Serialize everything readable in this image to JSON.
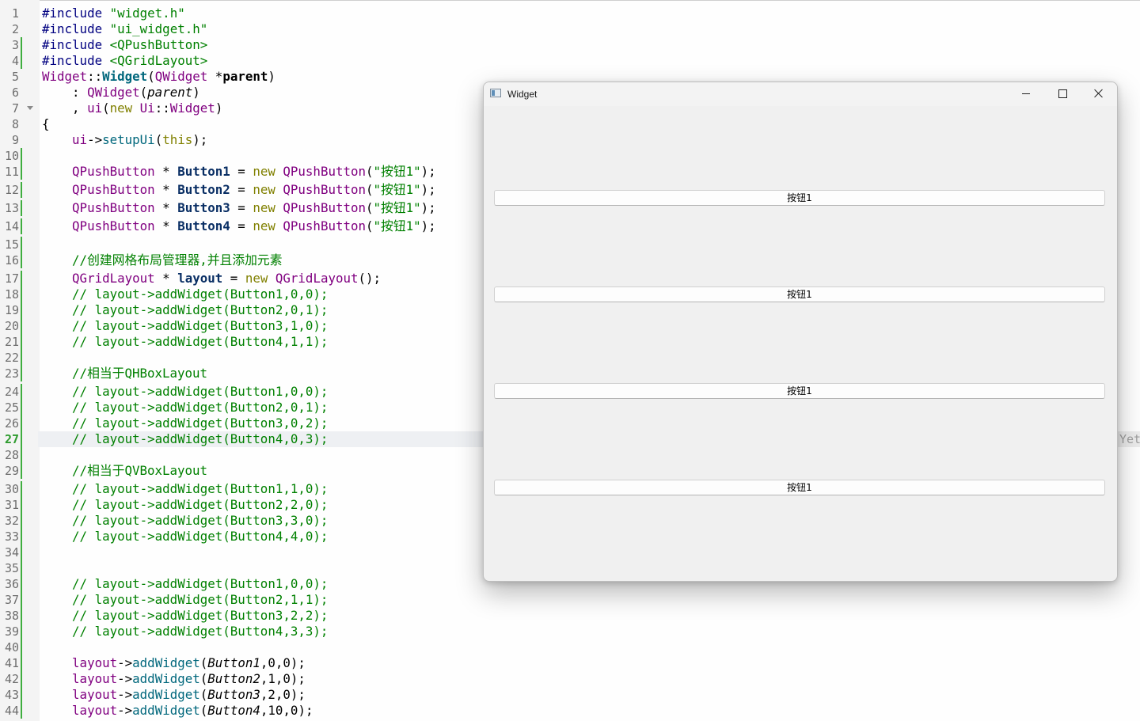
{
  "editor": {
    "current_line": 27,
    "modified_lines": [
      3,
      4,
      10,
      11,
      12,
      13,
      14,
      15,
      16,
      17,
      18,
      19,
      20,
      21,
      22,
      23,
      24,
      25,
      26,
      27,
      28,
      29,
      30,
      31,
      32,
      33,
      34,
      35,
      36,
      37,
      38,
      39,
      40,
      41,
      42,
      43,
      44
    ],
    "fold_markers": [
      7
    ],
    "lines": [
      {
        "n": "1",
        "tokens": [
          [
            "pp",
            "#include "
          ],
          [
            "str",
            "\"widget.h\""
          ]
        ]
      },
      {
        "n": "2",
        "tokens": [
          [
            "pp",
            "#include "
          ],
          [
            "str",
            "\"ui_widget.h\""
          ]
        ]
      },
      {
        "n": "3",
        "tokens": [
          [
            "pp",
            "#include "
          ],
          [
            "ang",
            "<QPushButton>"
          ]
        ]
      },
      {
        "n": "4",
        "tokens": [
          [
            "pp",
            "#include "
          ],
          [
            "ang",
            "<QGridLayout>"
          ]
        ]
      },
      {
        "n": "5",
        "tokens": [
          [
            "cls",
            "Widget"
          ],
          [
            "",
            "::"
          ],
          [
            "fnb",
            "Widget"
          ],
          [
            "",
            "("
          ],
          [
            "cls",
            "QWidget"
          ],
          [
            "",
            " *"
          ],
          [
            "b",
            "parent"
          ],
          [
            "",
            ")"
          ]
        ]
      },
      {
        "n": "6",
        "tokens": [
          [
            "",
            "    : "
          ],
          [
            "cls",
            "QWidget"
          ],
          [
            "",
            "("
          ],
          [
            "par",
            "parent"
          ],
          [
            "",
            ")"
          ]
        ]
      },
      {
        "n": "7",
        "tokens": [
          [
            "",
            "    , "
          ],
          [
            "ns",
            "ui"
          ],
          [
            "",
            "("
          ],
          [
            "kw",
            "new "
          ],
          [
            "cls",
            "Ui"
          ],
          [
            "",
            "::"
          ],
          [
            "cls",
            "Widget"
          ],
          [
            "",
            ")"
          ]
        ]
      },
      {
        "n": "8",
        "tokens": [
          [
            "",
            "{"
          ]
        ]
      },
      {
        "n": "9",
        "tokens": [
          [
            "",
            "    "
          ],
          [
            "ns",
            "ui"
          ],
          [
            "",
            "->"
          ],
          [
            "fn",
            "setupUi"
          ],
          [
            "",
            "("
          ],
          [
            "kw",
            "this"
          ],
          [
            "",
            ");"
          ]
        ]
      },
      {
        "n": "10",
        "tokens": []
      },
      {
        "n": "11",
        "tokens": [
          [
            "",
            "    "
          ],
          [
            "cls",
            "QPushButton"
          ],
          [
            "",
            " * "
          ],
          [
            "field",
            "Button1"
          ],
          [
            "",
            " = "
          ],
          [
            "kw",
            "new "
          ],
          [
            "cls",
            "QPushButton"
          ],
          [
            "",
            "("
          ],
          [
            "str",
            "\"按钮1\""
          ],
          [
            "",
            ");"
          ]
        ]
      },
      {
        "n": "12",
        "tokens": [
          [
            "",
            "    "
          ],
          [
            "cls",
            "QPushButton"
          ],
          [
            "",
            " * "
          ],
          [
            "field",
            "Button2"
          ],
          [
            "",
            " = "
          ],
          [
            "kw",
            "new "
          ],
          [
            "cls",
            "QPushButton"
          ],
          [
            "",
            "("
          ],
          [
            "str",
            "\"按钮1\""
          ],
          [
            "",
            ");"
          ]
        ]
      },
      {
        "n": "13",
        "tokens": [
          [
            "",
            "    "
          ],
          [
            "cls",
            "QPushButton"
          ],
          [
            "",
            " * "
          ],
          [
            "field",
            "Button3"
          ],
          [
            "",
            " = "
          ],
          [
            "kw",
            "new "
          ],
          [
            "cls",
            "QPushButton"
          ],
          [
            "",
            "("
          ],
          [
            "str",
            "\"按钮1\""
          ],
          [
            "",
            ");"
          ]
        ]
      },
      {
        "n": "14",
        "tokens": [
          [
            "",
            "    "
          ],
          [
            "cls",
            "QPushButton"
          ],
          [
            "",
            " * "
          ],
          [
            "field",
            "Button4"
          ],
          [
            "",
            " = "
          ],
          [
            "kw",
            "new "
          ],
          [
            "cls",
            "QPushButton"
          ],
          [
            "",
            "("
          ],
          [
            "str",
            "\"按钮1\""
          ],
          [
            "",
            ");"
          ]
        ]
      },
      {
        "n": "15",
        "tokens": []
      },
      {
        "n": "16",
        "tokens": [
          [
            "com",
            "    //创建网格布局管理器,并且添加元素"
          ]
        ]
      },
      {
        "n": "17",
        "tokens": [
          [
            "",
            "    "
          ],
          [
            "cls",
            "QGridLayout"
          ],
          [
            "",
            " * "
          ],
          [
            "field",
            "layout"
          ],
          [
            "",
            " = "
          ],
          [
            "kw",
            "new "
          ],
          [
            "cls",
            "QGridLayout"
          ],
          [
            "",
            "();"
          ]
        ]
      },
      {
        "n": "18",
        "tokens": [
          [
            "com",
            "    // layout->addWidget(Button1,0,0);"
          ]
        ]
      },
      {
        "n": "19",
        "tokens": [
          [
            "com",
            "    // layout->addWidget(Button2,0,1);"
          ]
        ]
      },
      {
        "n": "20",
        "tokens": [
          [
            "com",
            "    // layout->addWidget(Button3,1,0);"
          ]
        ]
      },
      {
        "n": "21",
        "tokens": [
          [
            "com",
            "    // layout->addWidget(Button4,1,1);"
          ]
        ]
      },
      {
        "n": "22",
        "tokens": []
      },
      {
        "n": "23",
        "tokens": [
          [
            "com",
            "    //相当于QHBoxLayout"
          ]
        ]
      },
      {
        "n": "24",
        "tokens": [
          [
            "com",
            "    // layout->addWidget(Button1,0,0);"
          ]
        ]
      },
      {
        "n": "25",
        "tokens": [
          [
            "com",
            "    // layout->addWidget(Button2,0,1);"
          ]
        ]
      },
      {
        "n": "26",
        "tokens": [
          [
            "com",
            "    // layout->addWidget(Button3,0,2);"
          ]
        ]
      },
      {
        "n": "27",
        "tokens": [
          [
            "com",
            "    // layout->addWidget(Button4,0,3);"
          ]
        ]
      },
      {
        "n": "28",
        "tokens": []
      },
      {
        "n": "29",
        "tokens": [
          [
            "com",
            "    //相当于QVBoxLayout"
          ]
        ]
      },
      {
        "n": "30",
        "tokens": [
          [
            "com",
            "    // layout->addWidget(Button1,1,0);"
          ]
        ]
      },
      {
        "n": "31",
        "tokens": [
          [
            "com",
            "    // layout->addWidget(Button2,2,0);"
          ]
        ]
      },
      {
        "n": "32",
        "tokens": [
          [
            "com",
            "    // layout->addWidget(Button3,3,0);"
          ]
        ]
      },
      {
        "n": "33",
        "tokens": [
          [
            "com",
            "    // layout->addWidget(Button4,4,0);"
          ]
        ]
      },
      {
        "n": "34",
        "tokens": []
      },
      {
        "n": "35",
        "tokens": []
      },
      {
        "n": "36",
        "tokens": [
          [
            "com",
            "    // layout->addWidget(Button1,0,0);"
          ]
        ]
      },
      {
        "n": "37",
        "tokens": [
          [
            "com",
            "    // layout->addWidget(Button2,1,1);"
          ]
        ]
      },
      {
        "n": "38",
        "tokens": [
          [
            "com",
            "    // layout->addWidget(Button3,2,2);"
          ]
        ]
      },
      {
        "n": "39",
        "tokens": [
          [
            "com",
            "    // layout->addWidget(Button4,3,3);"
          ]
        ]
      },
      {
        "n": "40",
        "tokens": []
      },
      {
        "n": "41",
        "tokens": [
          [
            "",
            "    "
          ],
          [
            "field2",
            "layout"
          ],
          [
            "",
            "->"
          ],
          [
            "fn",
            "addWidget"
          ],
          [
            "",
            "("
          ],
          [
            "par",
            "Button1"
          ],
          [
            "",
            ","
          ],
          [
            "",
            "0"
          ],
          [
            "",
            ","
          ],
          [
            "",
            "0"
          ],
          [
            "",
            ");"
          ]
        ]
      },
      {
        "n": "42",
        "tokens": [
          [
            "",
            "    "
          ],
          [
            "field2",
            "layout"
          ],
          [
            "",
            "->"
          ],
          [
            "fn",
            "addWidget"
          ],
          [
            "",
            "("
          ],
          [
            "par",
            "Button2"
          ],
          [
            "",
            ","
          ],
          [
            "",
            "1"
          ],
          [
            "",
            ","
          ],
          [
            "",
            "0"
          ],
          [
            "",
            ");"
          ]
        ]
      },
      {
        "n": "43",
        "tokens": [
          [
            "",
            "    "
          ],
          [
            "field2",
            "layout"
          ],
          [
            "",
            "->"
          ],
          [
            "fn",
            "addWidget"
          ],
          [
            "",
            "("
          ],
          [
            "par",
            "Button3"
          ],
          [
            "",
            ","
          ],
          [
            "",
            "2"
          ],
          [
            "",
            ","
          ],
          [
            "",
            "0"
          ],
          [
            "",
            ");"
          ]
        ]
      },
      {
        "n": "44",
        "tokens": [
          [
            "",
            "    "
          ],
          [
            "field2",
            "layout"
          ],
          [
            "",
            "->"
          ],
          [
            "fn",
            "addWidget"
          ],
          [
            "",
            "("
          ],
          [
            "par",
            "Button4"
          ],
          [
            "",
            ","
          ],
          [
            "",
            "10"
          ],
          [
            "",
            ","
          ],
          [
            "",
            "0"
          ],
          [
            "",
            ");"
          ]
        ]
      }
    ],
    "side_hint": "Yet"
  },
  "window": {
    "title": "Widget",
    "buttons": [
      "按钮1",
      "按钮1",
      "按钮1",
      "按钮1"
    ]
  },
  "colors": {
    "preprocessor": "#000080",
    "string": "#008000",
    "keyword": "#808000",
    "type": "#800080",
    "function": "#00677c",
    "comment": "#008000",
    "modified_marker": "#3fae3f"
  }
}
